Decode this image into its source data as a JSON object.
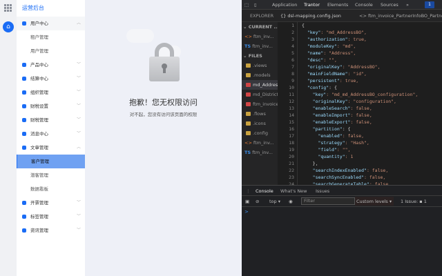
{
  "sidebar": {
    "brand": "运营后台",
    "items": [
      {
        "label": "用户中心",
        "type": "group",
        "open": true
      },
      {
        "label": "租户管理",
        "type": "sub"
      },
      {
        "label": "用户管理",
        "type": "sub"
      },
      {
        "label": "产品中心",
        "type": "group"
      },
      {
        "label": "结算中心",
        "type": "group"
      },
      {
        "label": "组织管理",
        "type": "group"
      },
      {
        "label": "财税设置",
        "type": "group"
      },
      {
        "label": "财税管理",
        "type": "group"
      },
      {
        "label": "消息中心",
        "type": "group"
      },
      {
        "label": "文章管理",
        "type": "group",
        "open": true
      },
      {
        "label": "客户管理",
        "type": "sub",
        "active": true
      },
      {
        "label": "潜客管理",
        "type": "sub"
      },
      {
        "label": "数据看板",
        "type": "sub"
      },
      {
        "label": "开票管理",
        "type": "group"
      },
      {
        "label": "标签管理",
        "type": "group"
      },
      {
        "label": "资讯管理",
        "type": "group"
      }
    ]
  },
  "main": {
    "title": "抱歉！您无权限访问",
    "desc": "对不起，您没有访问该页面的权限"
  },
  "devtools": {
    "tabs": [
      "Application",
      "Trantor",
      "Elements",
      "Console",
      "Sources"
    ],
    "more": "»",
    "issues_badge": "1",
    "explorer_label": "EXPLORER",
    "file_tabs": [
      "{} dsl-mapping.config.json",
      "<> ftm_invoice_PartnerInfoBO_Partne"
    ],
    "explorer": [
      {
        "label": "CURRENT ...",
        "kind": "header"
      },
      {
        "label": "ftm_inv...",
        "kind": "tag"
      },
      {
        "label": "ftm_inv...",
        "kind": "ts"
      },
      {
        "label": "FILES",
        "kind": "header"
      },
      {
        "label": ".views",
        "kind": "folder"
      },
      {
        "label": ".models",
        "kind": "folder"
      },
      {
        "label": "md_AddressBO",
        "kind": "db",
        "selected": true
      },
      {
        "label": "md_District",
        "kind": "db"
      },
      {
        "label": "ftm_invoice",
        "kind": "db"
      },
      {
        "label": ".flows",
        "kind": "folder"
      },
      {
        "label": ".icons",
        "kind": "folder"
      },
      {
        "label": ".config",
        "kind": "folder"
      },
      {
        "label": "ftm_inv...",
        "kind": "tag"
      },
      {
        "label": "ftm_inv...",
        "kind": "ts"
      }
    ],
    "code": [
      [
        "",
        "{",
        ""
      ],
      [
        "  ",
        "\"key\"",
        ": \"md_AddressBO\","
      ],
      [
        "  ",
        "\"authorization\"",
        ": true,"
      ],
      [
        "  ",
        "\"moduleKey\"",
        ": \"md\","
      ],
      [
        "  ",
        "\"name\"",
        ": \"Address\","
      ],
      [
        "  ",
        "\"desc\"",
        ": \"\","
      ],
      [
        "  ",
        "\"originalKey\"",
        ": \"AddressBO\","
      ],
      [
        "  ",
        "\"mainFieldName\"",
        ": \"id\","
      ],
      [
        "  ",
        "\"persistent\"",
        ": true,"
      ],
      [
        "  ",
        "\"config\"",
        ": {"
      ],
      [
        "    ",
        "\"key\"",
        ": \"md_md_AddressBO_configuration\","
      ],
      [
        "    ",
        "\"originalKey\"",
        ": \"configuration\","
      ],
      [
        "    ",
        "\"enableSearch\"",
        ": false,"
      ],
      [
        "    ",
        "\"enableImport\"",
        ": false,"
      ],
      [
        "    ",
        "\"enableExport\"",
        ": false,"
      ],
      [
        "    ",
        "\"partition\"",
        ": {"
      ],
      [
        "      ",
        "\"enabled\"",
        ": false,"
      ],
      [
        "      ",
        "\"strategy\"",
        ": \"Hash\","
      ],
      [
        "      ",
        "\"field\"",
        ": \"\","
      ],
      [
        "      ",
        "\"quantity\"",
        ": 1"
      ],
      [
        "    ",
        "",
        "},"
      ],
      [
        "    ",
        "\"searchIndexEnabled\"",
        ": false,"
      ],
      [
        "    ",
        "\"searchSyncEnabled\"",
        ": false,"
      ],
      [
        "    ",
        "\"searchGenerateTable\"",
        ": false,"
      ]
    ],
    "drawer": {
      "tabs": [
        "Console",
        "What's New",
        "Issues"
      ],
      "context": "top ▾",
      "filter_placeholder": "Filter",
      "levels": "Custom levels ▾",
      "issues": "1 Issue: ▪ 1",
      "prompt": ">"
    }
  }
}
